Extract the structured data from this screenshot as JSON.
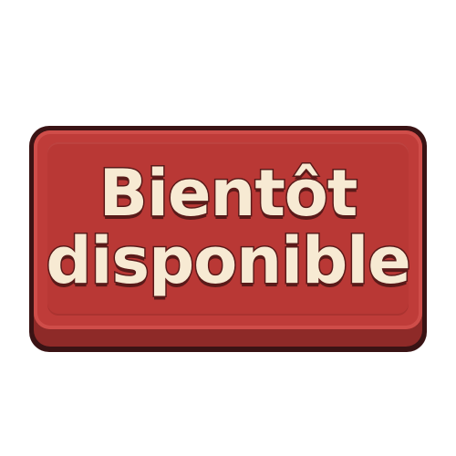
{
  "badge": {
    "line1": "Bientôt",
    "line2": "disponible"
  },
  "colors": {
    "face": "#bf3c39",
    "ledge": "#8e2a28",
    "outline": "#3a1314",
    "text": "#f7ead3",
    "text_outline": "#5a1a19"
  }
}
